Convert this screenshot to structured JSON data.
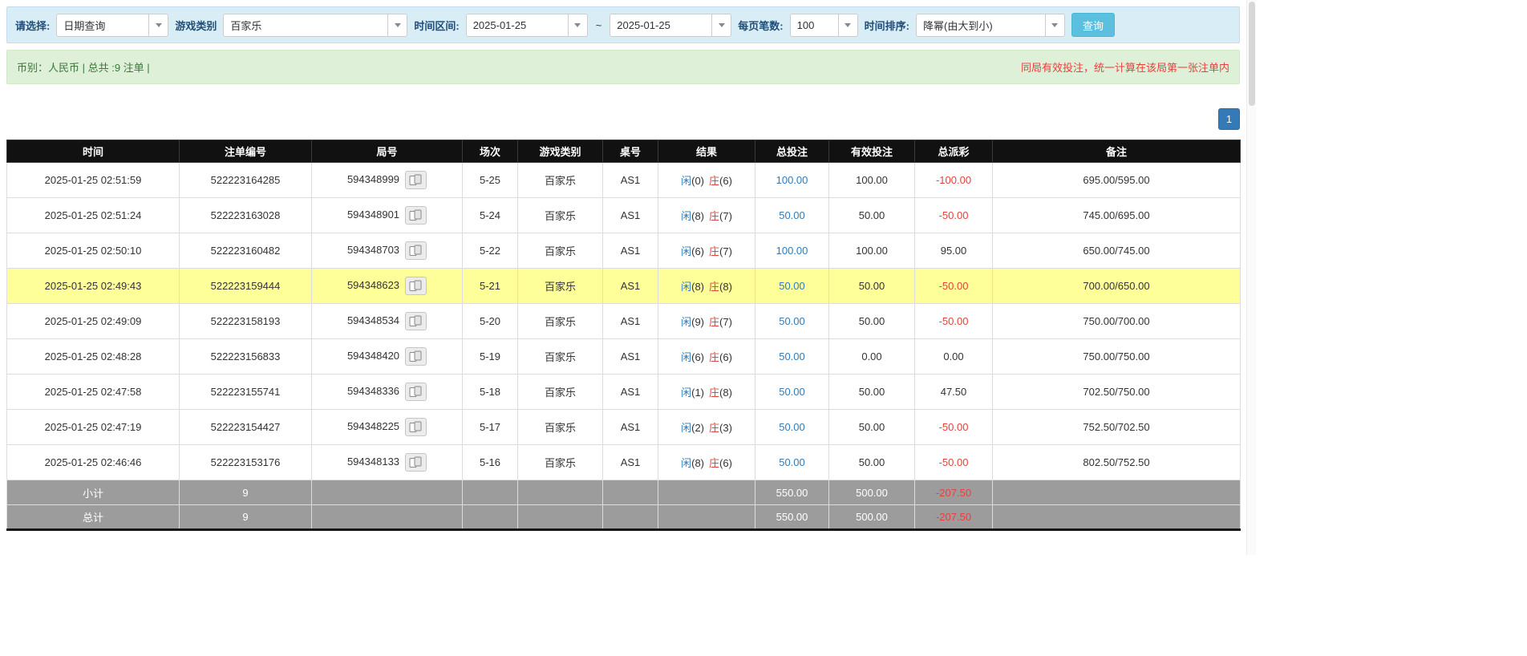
{
  "filter_bar": {
    "select_label": "请选择:",
    "select_value": "日期查询",
    "game_type_label": "游戏类别",
    "game_type_value": "百家乐",
    "date_range_label": "时间区间:",
    "date_from": "2025-01-25",
    "date_separator": "~",
    "date_to": "2025-01-25",
    "page_size_label": "每页笔数:",
    "page_size_value": "100",
    "sort_label": "时间排序:",
    "sort_value": "降幂(由大到小)",
    "search_button": "查询"
  },
  "info_bar": {
    "left_text": "币别：人民币 | 总共 :9 注单 |",
    "right_text": "同局有效投注，统一计算在该局第一张注单内"
  },
  "pagination": {
    "current_page": "1"
  },
  "table": {
    "headers": [
      "时间",
      "注单编号",
      "局号",
      "场次",
      "游戏类别",
      "桌号",
      "结果",
      "总投注",
      "有效投注",
      "总派彩",
      "备注"
    ],
    "rows": [
      {
        "time": "2025-01-25 02:51:59",
        "bet_id": "522223164285",
        "round_id": "594348999",
        "session": "5-25",
        "game_type": "百家乐",
        "table_no": "AS1",
        "result_player": "闲(0)",
        "result_banker": "庄(6)",
        "total_bet": "100.00",
        "valid_bet": "100.00",
        "payout": "-100.00",
        "remark": "695.00/595.00",
        "highlighted": false
      },
      {
        "time": "2025-01-25 02:51:24",
        "bet_id": "522223163028",
        "round_id": "594348901",
        "session": "5-24",
        "game_type": "百家乐",
        "table_no": "AS1",
        "result_player": "闲(8)",
        "result_banker": "庄(7)",
        "total_bet": "50.00",
        "valid_bet": "50.00",
        "payout": "-50.00",
        "remark": "745.00/695.00",
        "highlighted": false
      },
      {
        "time": "2025-01-25 02:50:10",
        "bet_id": "522223160482",
        "round_id": "594348703",
        "session": "5-22",
        "game_type": "百家乐",
        "table_no": "AS1",
        "result_player": "闲(6)",
        "result_banker": "庄(7)",
        "total_bet": "100.00",
        "valid_bet": "100.00",
        "payout": "95.00",
        "remark": "650.00/745.00",
        "highlighted": false
      },
      {
        "time": "2025-01-25 02:49:43",
        "bet_id": "522223159444",
        "round_id": "594348623",
        "session": "5-21",
        "game_type": "百家乐",
        "table_no": "AS1",
        "result_player": "闲(8)",
        "result_banker": "庄(8)",
        "total_bet": "50.00",
        "valid_bet": "50.00",
        "payout": "-50.00",
        "remark": "700.00/650.00",
        "highlighted": true
      },
      {
        "time": "2025-01-25 02:49:09",
        "bet_id": "522223158193",
        "round_id": "594348534",
        "session": "5-20",
        "game_type": "百家乐",
        "table_no": "AS1",
        "result_player": "闲(9)",
        "result_banker": "庄(7)",
        "total_bet": "50.00",
        "valid_bet": "50.00",
        "payout": "-50.00",
        "remark": "750.00/700.00",
        "highlighted": false
      },
      {
        "time": "2025-01-25 02:48:28",
        "bet_id": "522223156833",
        "round_id": "594348420",
        "session": "5-19",
        "game_type": "百家乐",
        "table_no": "AS1",
        "result_player": "闲(6)",
        "result_banker": "庄(6)",
        "total_bet": "50.00",
        "valid_bet": "0.00",
        "payout": "0.00",
        "remark": "750.00/750.00",
        "highlighted": false
      },
      {
        "time": "2025-01-25 02:47:58",
        "bet_id": "522223155741",
        "round_id": "594348336",
        "session": "5-18",
        "game_type": "百家乐",
        "table_no": "AS1",
        "result_player": "闲(1)",
        "result_banker": "庄(8)",
        "total_bet": "50.00",
        "valid_bet": "50.00",
        "payout": "47.50",
        "remark": "702.50/750.00",
        "highlighted": false
      },
      {
        "time": "2025-01-25 02:47:19",
        "bet_id": "522223154427",
        "round_id": "594348225",
        "session": "5-17",
        "game_type": "百家乐",
        "table_no": "AS1",
        "result_player": "闲(2)",
        "result_banker": "庄(3)",
        "total_bet": "50.00",
        "valid_bet": "50.00",
        "payout": "-50.00",
        "remark": "752.50/702.50",
        "highlighted": false
      },
      {
        "time": "2025-01-25 02:46:46",
        "bet_id": "522223153176",
        "round_id": "594348133",
        "session": "5-16",
        "game_type": "百家乐",
        "table_no": "AS1",
        "result_player": "闲(8)",
        "result_banker": "庄(6)",
        "total_bet": "50.00",
        "valid_bet": "50.00",
        "payout": "-50.00",
        "remark": "802.50/752.50",
        "highlighted": false
      }
    ],
    "subtotal": {
      "label": "小计",
      "count": "9",
      "total_bet": "550.00",
      "valid_bet": "500.00",
      "payout": "-207.50"
    },
    "total": {
      "label": "总计",
      "count": "9",
      "total_bet": "550.00",
      "valid_bet": "500.00",
      "payout": "-207.50"
    }
  },
  "colors": {
    "link_blue": "#337ab7",
    "negative_red": "#e8413c",
    "highlight_yellow": "#ffff99",
    "header_black": "#111111",
    "summary_gray": "#9c9c9c",
    "filter_bg": "#d9edf7",
    "info_bg": "#dff0d8",
    "query_button_blue": "#5bc0de"
  }
}
